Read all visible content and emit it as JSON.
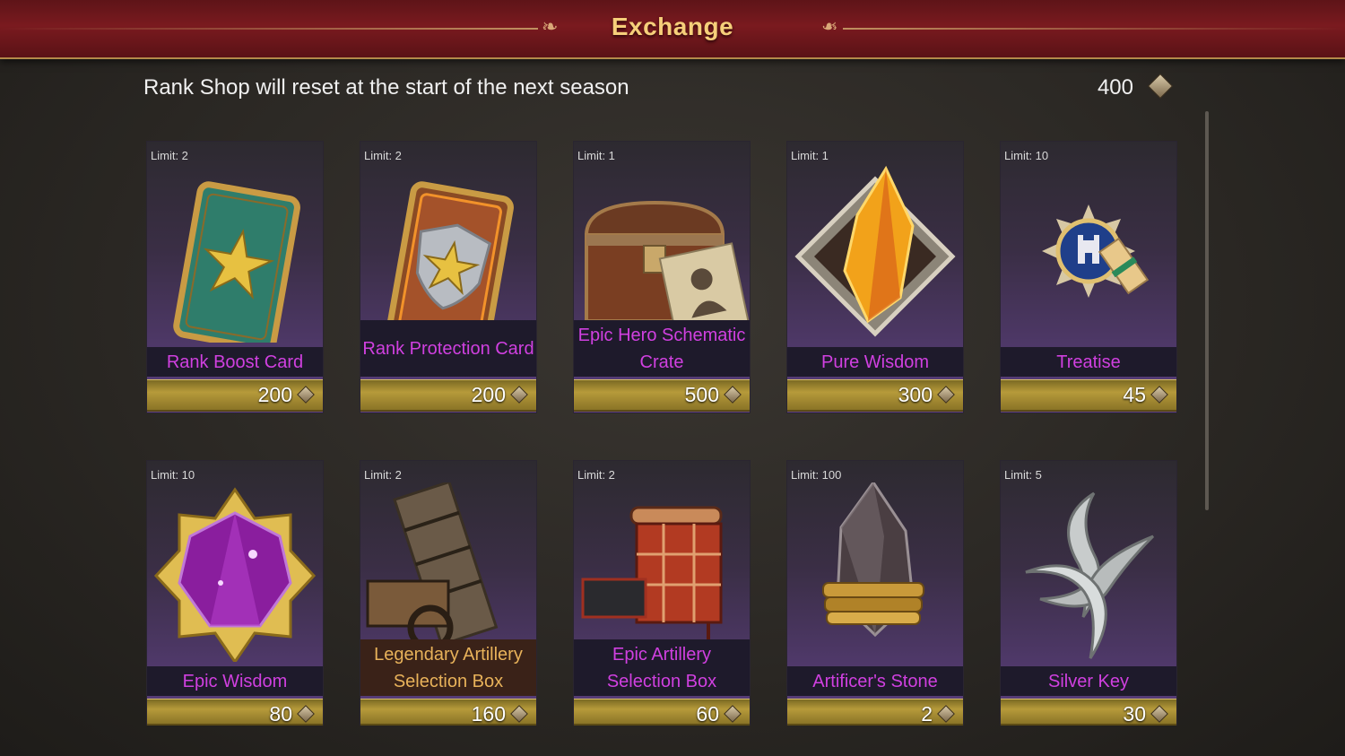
{
  "header": {
    "title": "Exchange"
  },
  "notice": "Rank Shop will reset at the start of the next season",
  "currency": {
    "amount": "400",
    "icon": "rank-coin-icon"
  },
  "items": [
    {
      "limit": "Limit: 2",
      "name": "Rank Boost Card",
      "price": "200",
      "icon": "rank-boost-card-icon"
    },
    {
      "limit": "Limit: 2",
      "name": "Rank Protection Card",
      "price": "200",
      "icon": "rank-protection-card-icon"
    },
    {
      "limit": "Limit: 1",
      "name": "Epic Hero Schematic Crate",
      "price": "500",
      "icon": "schematic-crate-icon"
    },
    {
      "limit": "Limit: 1",
      "name": "Pure Wisdom",
      "price": "300",
      "icon": "pure-wisdom-icon"
    },
    {
      "limit": "Limit: 10",
      "name": "Treatise",
      "price": "45",
      "icon": "treatise-icon"
    },
    {
      "limit": "Limit: 10",
      "name": "Epic Wisdom",
      "price": "80",
      "icon": "epic-wisdom-icon"
    },
    {
      "limit": "Limit: 2",
      "name": "Legendary Artillery Selection Box",
      "price": "160",
      "icon": "legendary-artillery-icon"
    },
    {
      "limit": "Limit: 2",
      "name": "Epic Artillery Selection Box",
      "price": "60",
      "icon": "epic-artillery-icon"
    },
    {
      "limit": "Limit: 100",
      "name": "Artificer's Stone",
      "price": "2",
      "icon": "artificers-stone-icon"
    },
    {
      "limit": "Limit: 5",
      "name": "Silver Key",
      "price": "30",
      "icon": "silver-key-icon"
    }
  ],
  "colors": {
    "epic_name": "#d040e0",
    "legendary_name": "#e8b25a",
    "header_red": "#7a1a1f",
    "title_gold": "#f6cf7a"
  }
}
